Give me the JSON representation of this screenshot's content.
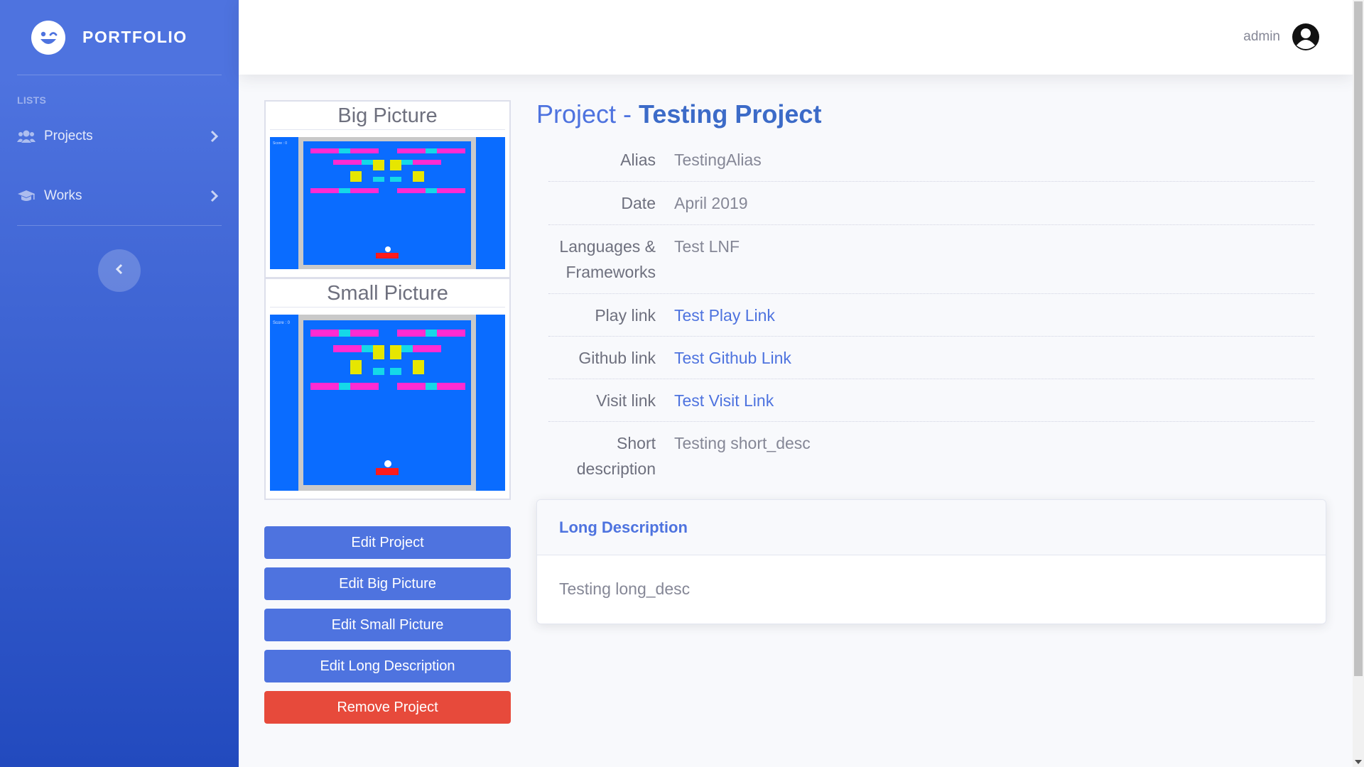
{
  "brand": {
    "name": "PORTFOLIO"
  },
  "sidebar": {
    "heading": "LISTS",
    "items": [
      {
        "label": "Projects",
        "icon": "users-icon"
      },
      {
        "label": "Works",
        "icon": "graduation-cap-icon"
      }
    ]
  },
  "topbar": {
    "user": "admin"
  },
  "pictures": {
    "big_title": "Big Picture",
    "small_title": "Small Picture",
    "score_label": "Score : 0"
  },
  "actions": {
    "edit_project": "Edit Project",
    "edit_big_picture": "Edit Big Picture",
    "edit_small_picture": "Edit Small Picture",
    "edit_long_description": "Edit Long Description",
    "remove_project": "Remove Project"
  },
  "project": {
    "title_prefix": "Project - ",
    "name": "Testing Project",
    "fields": [
      {
        "label": "Alias",
        "value": "TestingAlias"
      },
      {
        "label": "Date",
        "value": "April 2019"
      },
      {
        "label": "Languages & Frameworks",
        "value": "Test LNF"
      },
      {
        "label": "Play link",
        "value": "Test Play Link"
      },
      {
        "label": "Github link",
        "value": "Test Github Link"
      },
      {
        "label": "Visit link",
        "value": "Test Visit Link"
      },
      {
        "label": "Short description",
        "value": "Testing short_desc"
      }
    ],
    "long_description_title": "Long Description",
    "long_description": "Testing long_desc"
  },
  "colors": {
    "primary": "#4e73df",
    "danger": "#e74a3b",
    "game_blue": "#0a6cff",
    "brick_magenta": "#ff2bd2",
    "brick_cyan": "#15d8e8",
    "brick_yellow": "#e6e600",
    "paddle_red": "#ff1a1a"
  }
}
